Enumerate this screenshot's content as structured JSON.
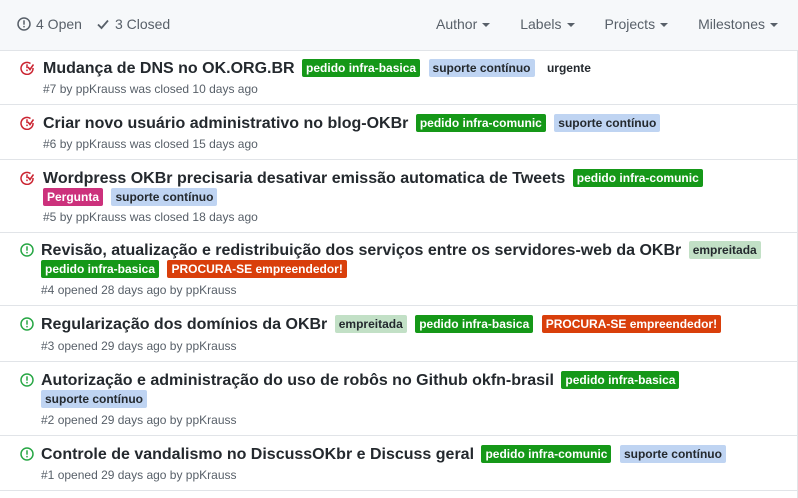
{
  "header": {
    "open_label": "4 Open",
    "closed_label": "3 Closed",
    "filters": [
      "Author",
      "Labels",
      "Projects",
      "Milestones"
    ]
  },
  "colors": {
    "closed_icon": "#cb2431",
    "open_icon": "#28a745",
    "label_green": "#159818",
    "label_blue": "#bfd4f2",
    "label_pale_green": "#c2e0c6",
    "label_magenta": "#cc317c",
    "label_orange": "#d93f0b"
  },
  "issues": [
    {
      "state": "closed",
      "title": "Mudança de DNS no OK.ORG.BR",
      "labels": [
        "pedido infra-basica",
        "suporte contínuo",
        "urgente"
      ],
      "number": "#7",
      "meta": "by ppKrauss was closed 10 days ago"
    },
    {
      "state": "closed",
      "title": "Criar novo usuário administrativo no blog-OKBr",
      "labels": [
        "pedido infra-comunic",
        "suporte contínuo"
      ],
      "number": "#6",
      "meta": "by ppKrauss was closed 15 days ago"
    },
    {
      "state": "closed",
      "title": "Wordpress OKBr precisaria desativar emissão automatica de Tweets",
      "labels": [
        "pedido infra-comunic",
        "Pergunta",
        "suporte contínuo"
      ],
      "number": "#5",
      "meta": "by ppKrauss was closed 18 days ago"
    },
    {
      "state": "open",
      "title": "Revisão, atualização e redistribuição dos serviços entre os servidores-web da OKBr",
      "labels": [
        "empreitada",
        "pedido infra-basica",
        "PROCURA-SE empreendedor!"
      ],
      "number": "#4",
      "meta": "opened 28 days ago by ppKrauss"
    },
    {
      "state": "open",
      "title": "Regularização dos domínios da OKBr",
      "labels": [
        "empreitada",
        "pedido infra-basica",
        "PROCURA-SE empreendedor!"
      ],
      "number": "#3",
      "meta": "opened 29 days ago by ppKrauss"
    },
    {
      "state": "open",
      "title": "Autorização e administração do uso de robôs no Github okfn-brasil",
      "labels": [
        "pedido infra-basica",
        "suporte contínuo"
      ],
      "number": "#2",
      "meta": "opened 29 days ago by ppKrauss"
    },
    {
      "state": "open",
      "title": "Controle de vandalismo no DiscussOKbr e Discuss geral",
      "labels": [
        "pedido infra-comunic",
        "suporte contínuo"
      ],
      "number": "#1",
      "meta": "opened 29 days ago by ppKrauss"
    }
  ]
}
